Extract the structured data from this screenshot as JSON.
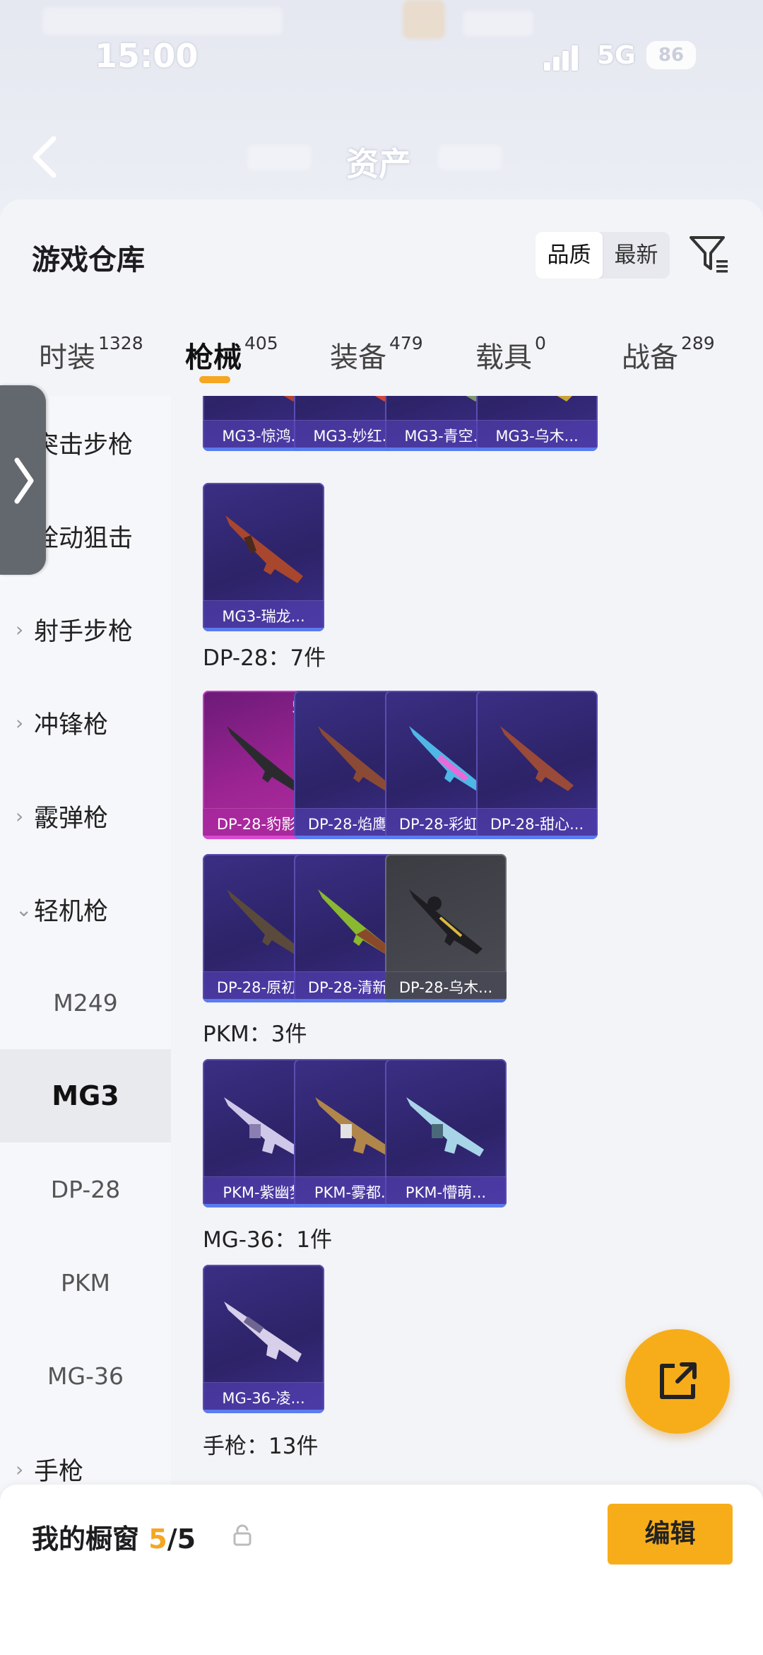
{
  "status_bar": {
    "time": "15:00",
    "network": "5G",
    "battery": "86"
  },
  "header": {
    "title": "资产"
  },
  "panel": {
    "title": "游戏仓库",
    "sort": {
      "quality": "品质",
      "newest": "最新"
    }
  },
  "tabs": [
    {
      "label": "时装",
      "count": "1328"
    },
    {
      "label": "枪械",
      "count": "405"
    },
    {
      "label": "装备",
      "count": "479"
    },
    {
      "label": "载具",
      "count": "0"
    },
    {
      "label": "战备",
      "count": "289"
    }
  ],
  "sidebar": {
    "items": [
      {
        "label": "突击步枪"
      },
      {
        "label": "栓动狙击"
      },
      {
        "label": "射手步枪"
      },
      {
        "label": "冲锋枪"
      },
      {
        "label": "霰弹枪"
      },
      {
        "label": "轻机枪"
      },
      {
        "label": "M249"
      },
      {
        "label": "MG3"
      },
      {
        "label": "DP-28"
      },
      {
        "label": "PKM"
      },
      {
        "label": "MG-36"
      },
      {
        "label": "手枪"
      }
    ]
  },
  "mg3_cards": [
    {
      "name": "MG3-惊鸿..."
    },
    {
      "name": "MG3-妙红..."
    },
    {
      "name": "MG3-青空..."
    },
    {
      "name": "MG3-乌木..."
    },
    {
      "name": "MG3-瑞龙..."
    }
  ],
  "sections": {
    "dp28": "DP-28：7件",
    "pkm": "PKM：3件",
    "mg36": "MG-36：1件",
    "pistol": "手枪：13件"
  },
  "dp28_cards": [
    {
      "name": "DP-28-豹影...",
      "level": "5级"
    },
    {
      "name": "DP-28-焰鹰..."
    },
    {
      "name": "DP-28-彩虹..."
    },
    {
      "name": "DP-28-甜心..."
    },
    {
      "name": "DP-28-原初..."
    },
    {
      "name": "DP-28-清新..."
    },
    {
      "name": "DP-28-乌木..."
    }
  ],
  "pkm_cards": [
    {
      "name": "PKM-紫幽梦"
    },
    {
      "name": "PKM-雾都..."
    },
    {
      "name": "PKM-懵萌..."
    }
  ],
  "mg36_cards": [
    {
      "name": "MG-36-凌..."
    }
  ],
  "bottom": {
    "showcase": "我的橱窗",
    "count_now": "5",
    "count_total": "/5",
    "edit": "编辑"
  },
  "colors": {
    "accent": "#f7ad1a",
    "card_purple": "#2d2368",
    "card_pink": "#9b2492"
  }
}
